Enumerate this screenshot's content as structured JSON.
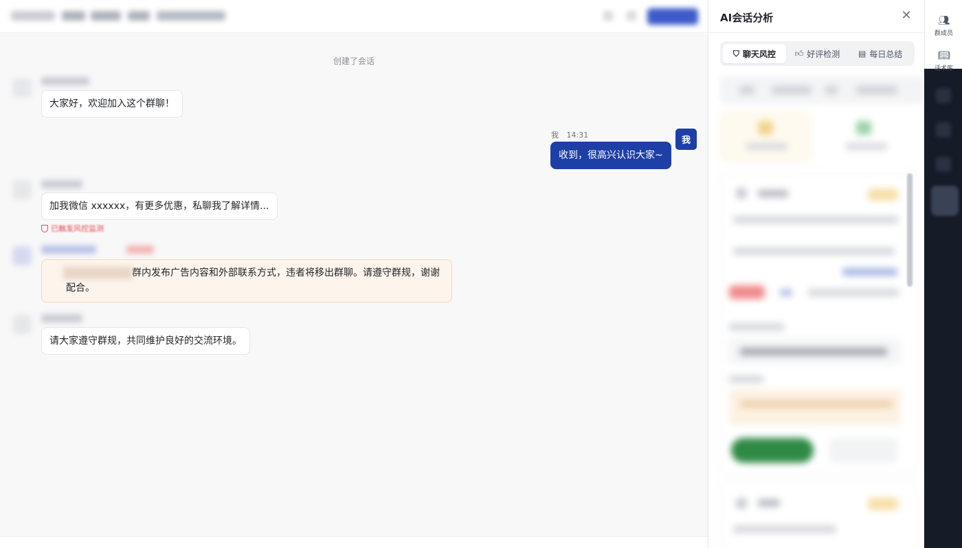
{
  "chat": {
    "system_note": "创建了会话",
    "messages": [
      {
        "text": "大家好，欢迎加入这个群聊！"
      },
      {
        "sender": "我",
        "time": "14:31",
        "text": "收到，很高兴认识大家~",
        "avatar_label": "我"
      },
      {
        "text": "加我微信 xxxxxx，有更多优惠，私聊我了解详情...",
        "risk_flag": "已触发风控监测"
      },
      {
        "text": "群内发布广告内容和外部联系方式，违者将移出群聊。请遵守群规，谢谢配合。"
      },
      {
        "text": "请大家遵守群规，共同维护良好的交流环境。"
      }
    ]
  },
  "ai_panel": {
    "title": "AI会话分析",
    "close_icon": "close-icon",
    "tabs": [
      {
        "label": "聊天风控",
        "icon": "shield-icon",
        "active": true
      },
      {
        "label": "好评检测",
        "icon": "thumbs-up-icon",
        "active": false
      },
      {
        "label": "每日总结",
        "icon": "document-icon",
        "active": false
      }
    ]
  },
  "sidebar": {
    "items": [
      {
        "label": "群成员",
        "icon": "members-icon"
      },
      {
        "label": "话术库",
        "icon": "book-icon"
      }
    ]
  },
  "colors": {
    "primary": "#1d3fa6",
    "risk": "#e5484d",
    "warn_bg": "#fdf4ec",
    "sidebar_bg": "#161b28"
  }
}
